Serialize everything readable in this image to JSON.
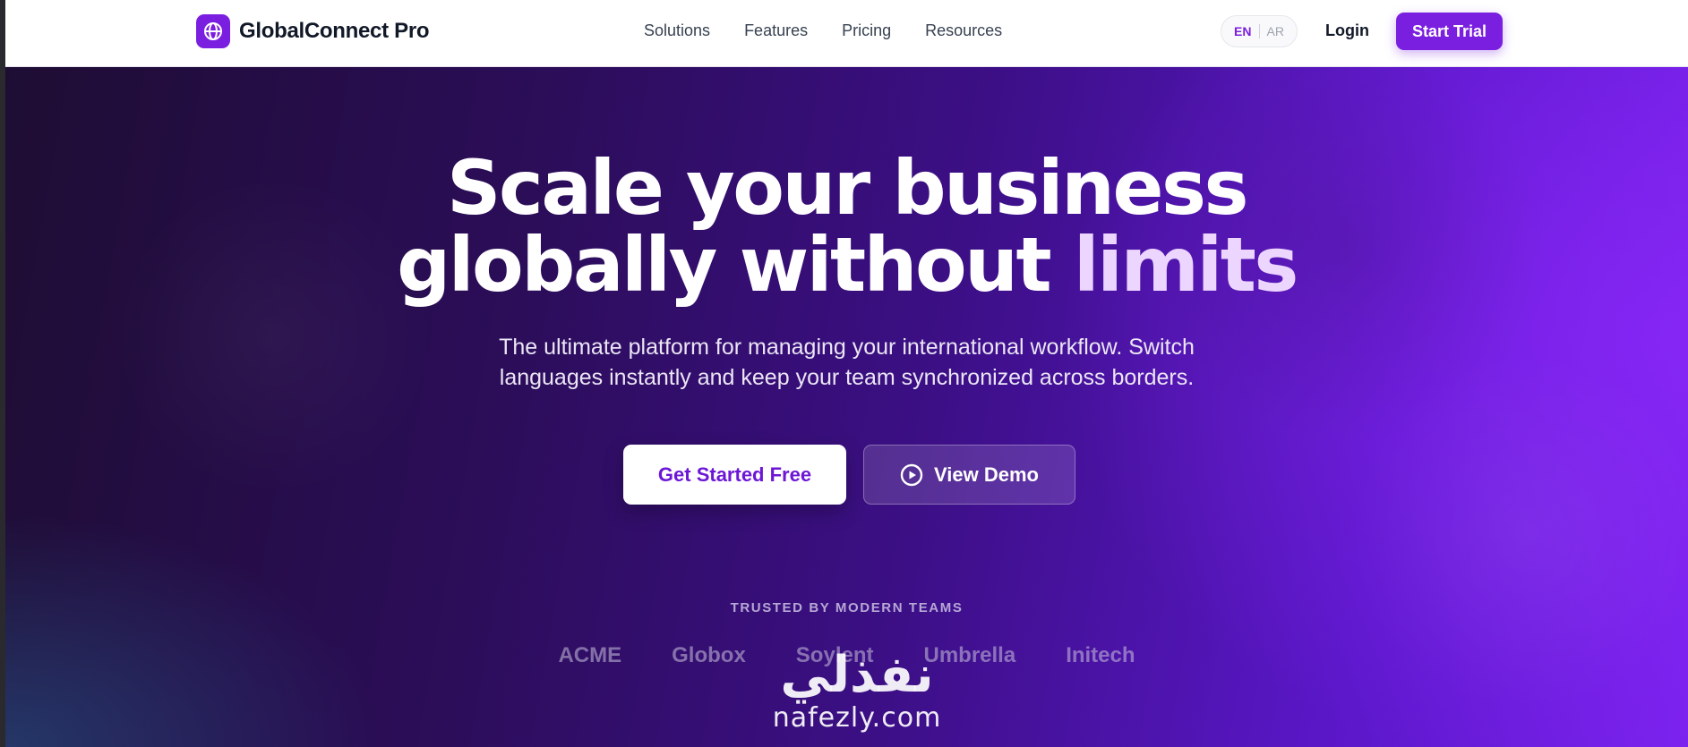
{
  "brand": {
    "name": "GlobalConnect Pro",
    "logo_icon": "globe-icon"
  },
  "nav": {
    "links": [
      "Solutions",
      "Features",
      "Pricing",
      "Resources"
    ],
    "languages": {
      "active": "EN",
      "other": "AR"
    },
    "login_label": "Login",
    "cta_label": "Start Trial"
  },
  "hero": {
    "headline_line1": "Scale your business",
    "headline_line2_main": "globally without ",
    "headline_line2_accent": "limits",
    "subtitle_line1": "The ultimate platform for managing your international workflow. Switch",
    "subtitle_line2": "languages instantly and keep your team synchronized across borders.",
    "primary_cta": "Get Started Free",
    "secondary_cta": "View Demo",
    "secondary_cta_icon": "play-circle-icon"
  },
  "trusted": {
    "heading": "TRUSTED BY MODERN TEAMS",
    "logos": [
      "ACME",
      "Globox",
      "Soylent",
      "Umbrella",
      "Initech"
    ]
  },
  "watermark": {
    "arabic": "نفذلي",
    "latin": "nafezly.com"
  },
  "colors": {
    "accent": "#7a1fe0",
    "accent_light": "#ecd6ff",
    "hero_dark": "#1e0d33"
  }
}
